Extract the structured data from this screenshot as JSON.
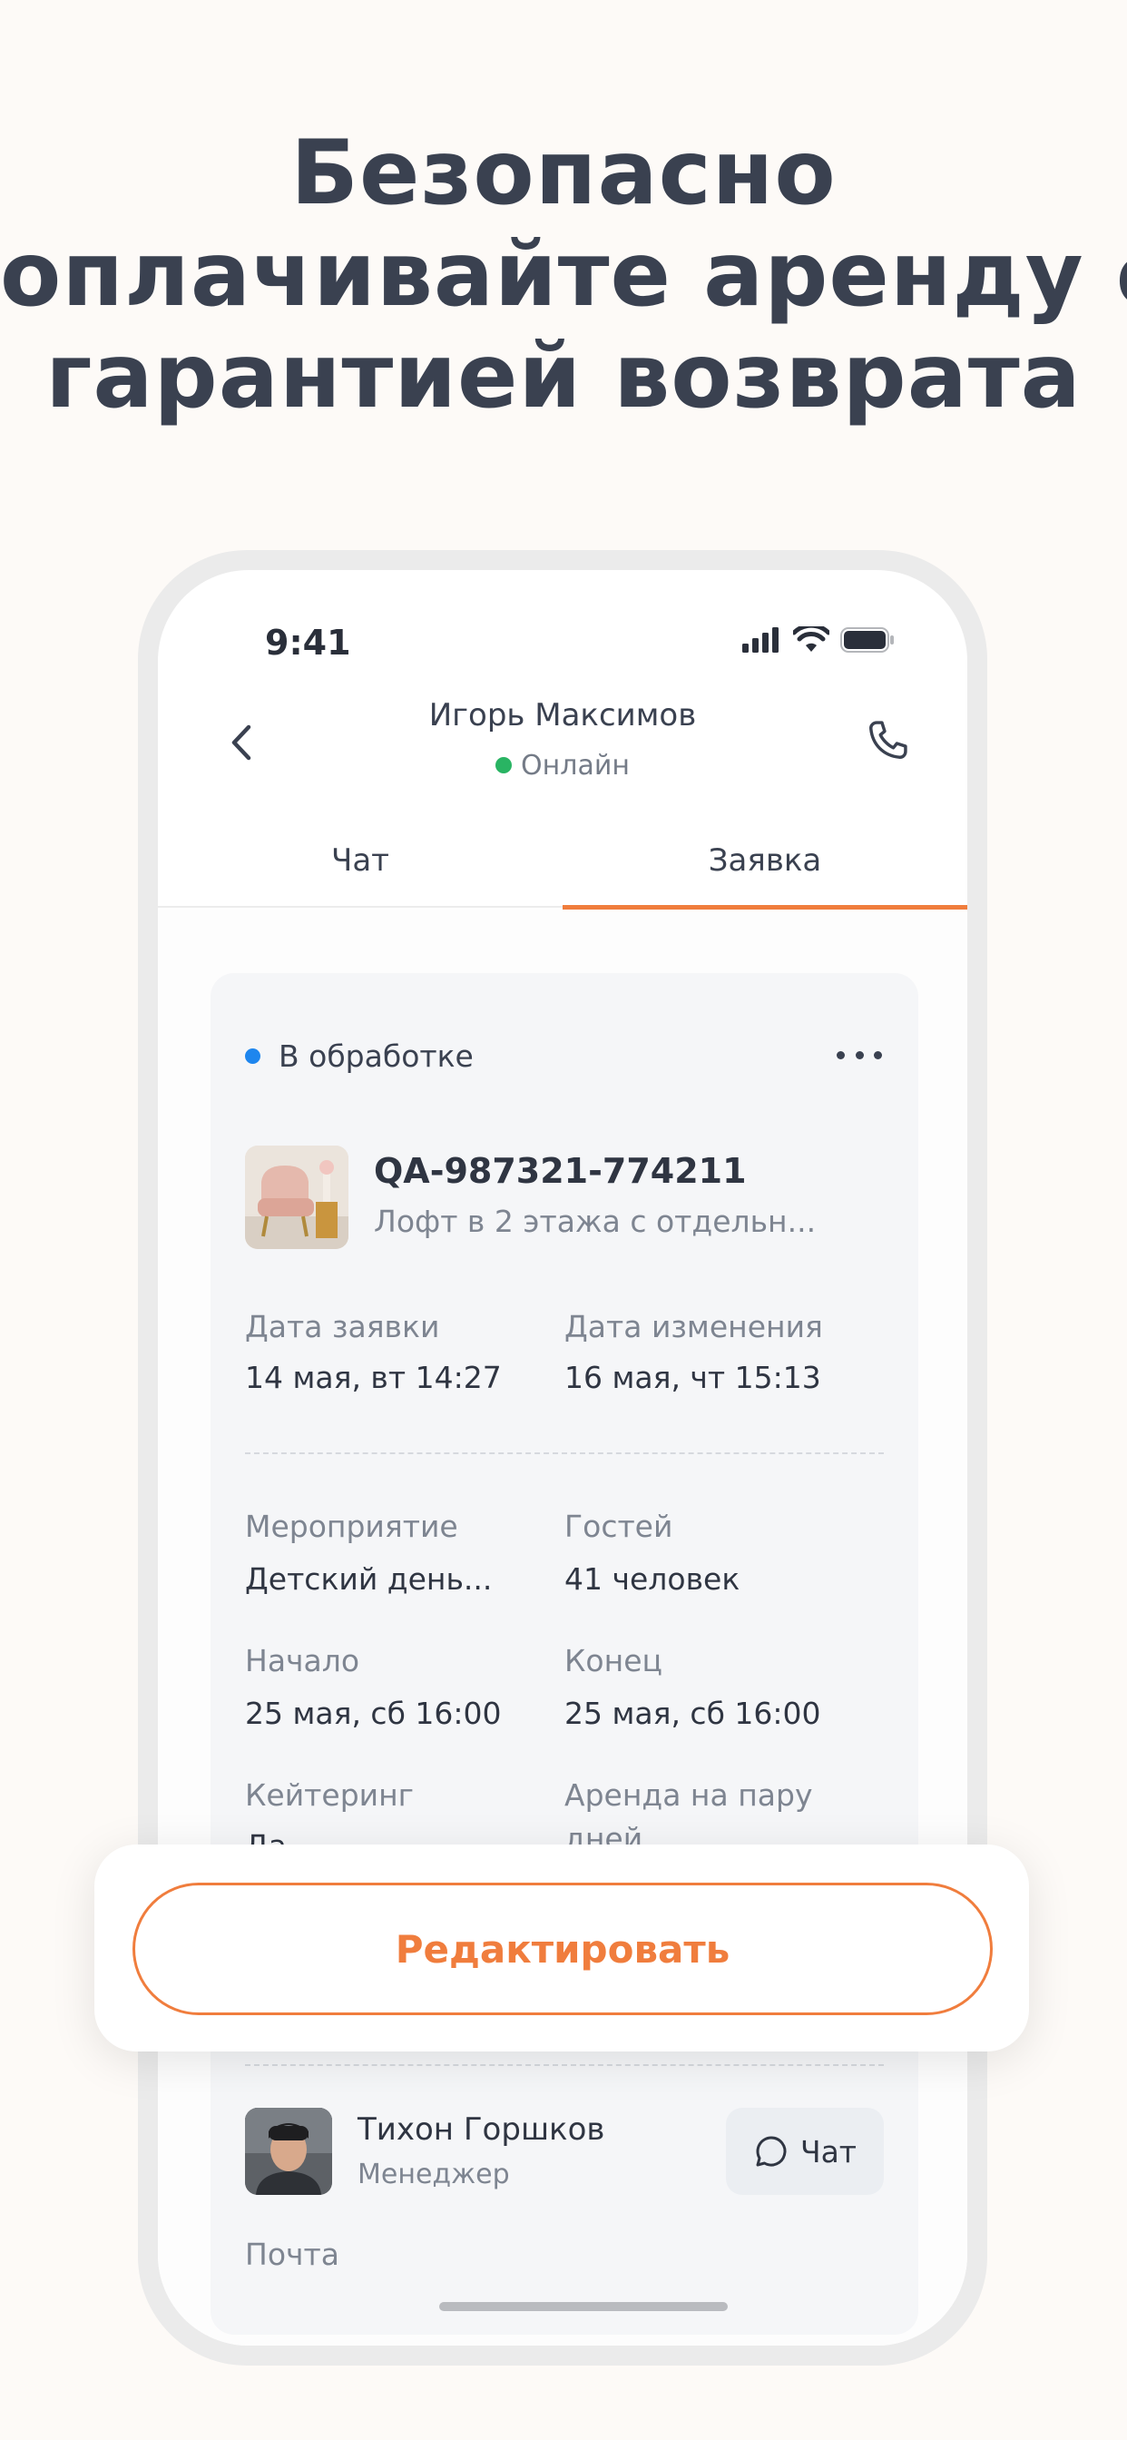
{
  "headline": {
    "line1": "Безопасно",
    "line2": "оплачивайте аренду с",
    "line3": "гарантией возврата"
  },
  "status_bar": {
    "time": "9:41"
  },
  "header": {
    "contact_name": "Игорь Максимов",
    "contact_status": "Онлайн"
  },
  "tabs": [
    {
      "label": "Чат",
      "active": false
    },
    {
      "label": "Заявка",
      "active": true
    }
  ],
  "request": {
    "status": "В обработке",
    "id": "QA-987321-774211",
    "title": "Лофт в 2 этажа с отдельн...",
    "fields": [
      {
        "label": "Дата заявки",
        "value": "14 мая, вт 14:27"
      },
      {
        "label": "Дата изменения",
        "value": "16 мая, чт 15:13"
      },
      {
        "label": "Мероприятие",
        "value": "Детский день..."
      },
      {
        "label": "Гостей",
        "value": "41 человек"
      },
      {
        "label": "Начало",
        "value": "25 мая, сб 16:00"
      },
      {
        "label": "Конец",
        "value": "25 мая, сб 16:00"
      },
      {
        "label": "Кейтеринг",
        "value": "Да"
      },
      {
        "label": "Аренда на пару дней",
        "value": ""
      }
    ],
    "catering_label": "Кейтеринг",
    "catering_value": "Да",
    "rent_label_line1": "Аренда на пару",
    "rent_label_line2": "дней"
  },
  "manager": {
    "name": "Тихон Горшков",
    "role": "Менеджер",
    "chat_label": "Чат"
  },
  "email_label": "Почта",
  "edit_button": "Редактировать",
  "colors": {
    "accent": "#f07d3d",
    "online": "#29b463",
    "status_processing": "#1e86ee",
    "text": "#3a4150",
    "background": "#fdfaf7"
  }
}
